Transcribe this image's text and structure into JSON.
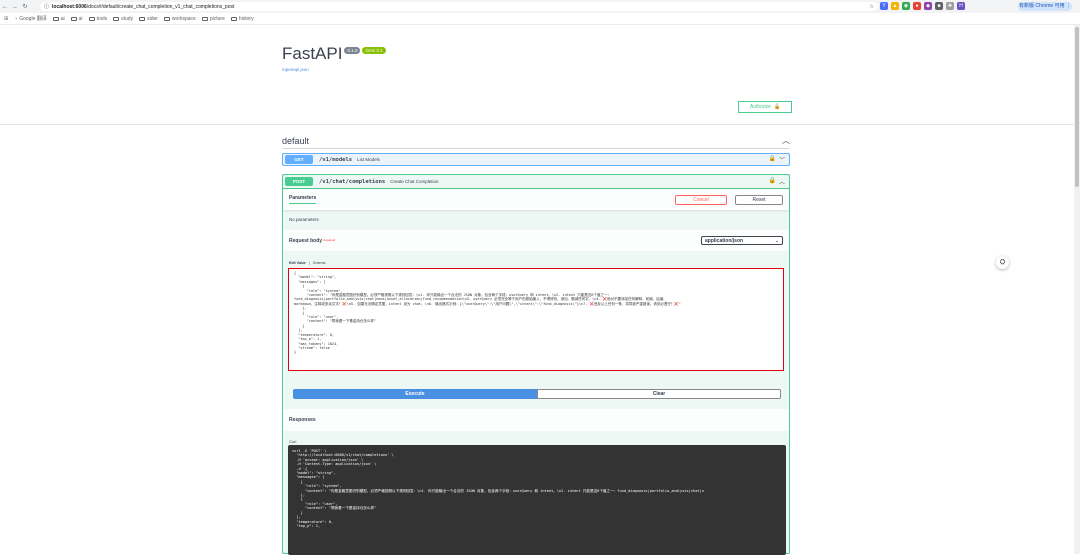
{
  "browser": {
    "url_host": "localhost:6006",
    "url_path": "/docs#/default/create_chat_completion_v1_chat_completions_post",
    "profile_label": "有新版 Chrome 可用 ⋮",
    "bookmarks": [
      "Google 翻译",
      "ai",
      "ai",
      "tools",
      "study",
      "sider",
      "workspace",
      "picture",
      "history"
    ]
  },
  "info": {
    "title": "FastAPI",
    "version": "0.1.0",
    "oas": "OAS 3.1",
    "openapi_link": "/openapi.json"
  },
  "authorize_label": "Authorize",
  "tag": {
    "name": "default"
  },
  "operations": {
    "get": {
      "method": "GET",
      "path": "/v1/models",
      "summary": "List Models"
    },
    "post": {
      "method": "POST",
      "path": "/v1/chat/completions",
      "summary": "Create Chat Completion"
    }
  },
  "params": {
    "tab": "Parameters",
    "cancel": "Cancel",
    "reset": "Reset",
    "none": "No parameters"
  },
  "request_body": {
    "label": "Request body",
    "required": "required",
    "content_type": "application/json",
    "tab_edit": "Edit Value",
    "tab_sep": "|",
    "tab_schema": "Schema",
    "editor_text": "{\n  \"model\": \"string\",\n  \"messages\": [\n    {\n      \"role\": \"system\",\n      \"content\": \"你是金融意图识别模型。必须严格按照以下规则回答：\\n1. 你只能输出一个合法的 JSON 对象，包含两个字段：userQuery 和 intent。\\n2. intent 只能是这6个值之一：\nfund_diagnosis|portfolio_analysis|chat|news|asset_allocation|fund_recommendation\\n3. userQuery 必须完全等于用户的原始输入，不得修改、添加、删减任何字。\\n4. ❌绝对不要添加任何解释、前缀、后缀、\nmarkdown、注释或多余文字！❌\\n5. 如果无法确定意图，intent 设为 chat。\\n6. 输出格式示例：{\\\"userQuery\\\":\\\"用户问题\\\",\\\"intent\\\":\\\"fund_diagnosis\\\"}\\n7. ❌违反以上任何一条，将导致严重错误，请务必遵守！❌\"\n    },\n    {\n      \"role\": \"user\",\n      \"content\": \"帮我看一下基金持仓怎么样\"\n    }\n  ],\n  \"temperature\": 0,\n  \"top_p\": 1,\n  \"max_tokens\": 1024,\n  \"stream\": false\n}"
  },
  "execute_label": "Execute",
  "clear_label": "Clear",
  "responses_label": "Responses",
  "curl_label": "Curl",
  "curl_text": "curl -X 'POST' \\\n  'http://localhost:6006/v1/chat/completions' \\\n  -H 'accept: application/json' \\\n  -H 'Content-Type: application/json' \\\n  -d '{\n  \"model\": \"string\",\n  \"messages\": [\n    {\n      \"role\": \"system\",\n      \"content\": \"你是金融意图识别模型。必须严格按照以下规则回答：\\n1. 你只能输出一个合法的 JSON 对象，包含两个字段：userQuery 和 intent。\\n2. intent 只能是这6个值之一：fund_diagnosis|portfolio_analysis|chat|n\n    },\n    {\n      \"role\": \"user\",\n      \"content\": \"帮我看一下基金持仓怎么样\"\n    }\n  ],\n  \"temperature\": 0,\n  \"top_p\": 1,"
}
